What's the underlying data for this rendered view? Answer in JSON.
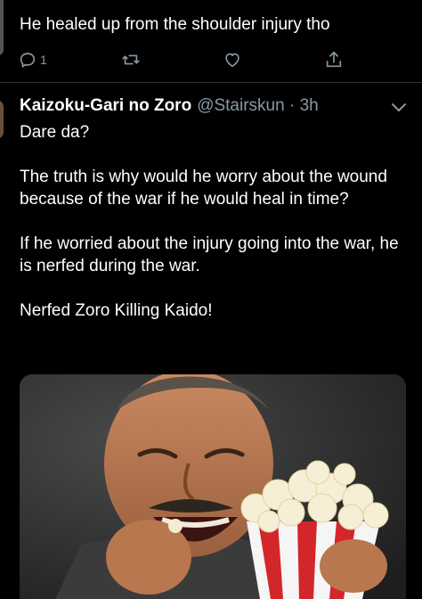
{
  "previous_tweet": {
    "text": "He healed up from the shoulder injury tho",
    "actions": {
      "reply_count": "1",
      "reply_icon": "reply-icon",
      "retweet_icon": "retweet-icon",
      "like_icon": "heart-icon",
      "share_icon": "share-icon"
    }
  },
  "tweet": {
    "display_name": "Kaizoku-Gari no Zoro",
    "handle": "@Stairskun",
    "separator": "·",
    "time": "3h",
    "paragraphs": [
      "Dare da?",
      "The truth is why would he worry about the wound because of the war if he would heal in time?",
      "If he worried about the injury going into the war, he is nerfed during the war.",
      "Nerfed Zoro Killing Kaido!"
    ],
    "media_icon": "laughing-man-popcorn-meme-image"
  },
  "colors": {
    "background": "#000000",
    "text": "#ffffff",
    "muted": "#8899a6",
    "divider": "#2f3336"
  }
}
